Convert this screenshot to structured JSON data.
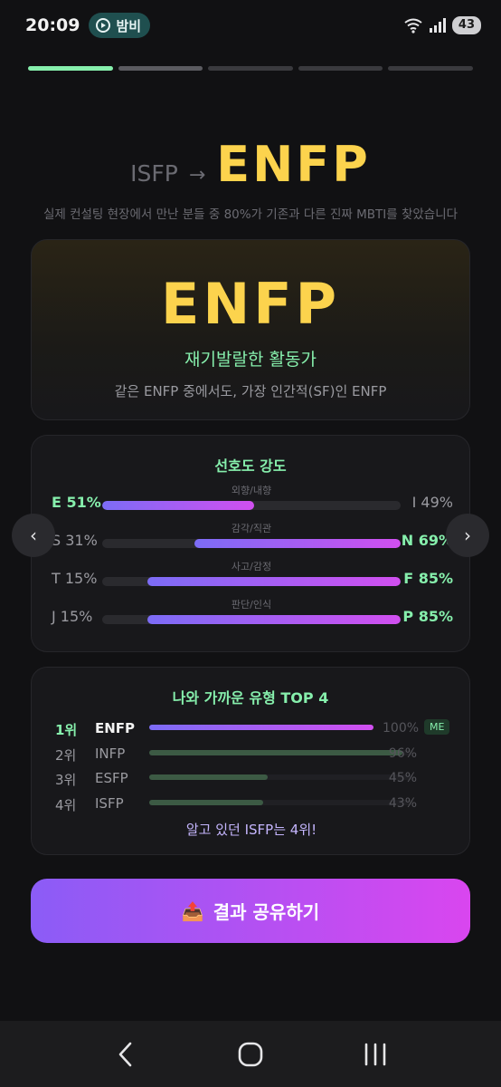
{
  "status_bar": {
    "time": "20:09",
    "app_label": "밤비",
    "battery": "43",
    "icons": [
      "wifi-icon",
      "signal-icon",
      "battery-icon"
    ]
  },
  "progress": {
    "total_steps": 5,
    "current_step": 1
  },
  "headline": {
    "from_type": "ISFP",
    "arrow": "→",
    "to_type": "ENFP",
    "subtitle": "실제 컨설팅 현장에서 만난 분들 중 80%가 기존과 다른 진짜 MBTI를 찾았습니다"
  },
  "result_card": {
    "type": "ENFP",
    "name": "재기발랄한 활동가",
    "description": "같은 ENFP 중에서도, 가장 인간적(SF)인 ENFP"
  },
  "preference": {
    "title": "선호도 강도",
    "rows": [
      {
        "caption": "외향/내향",
        "left": "E 51%",
        "right": "I 49%",
        "left_pct": 51,
        "right_pct": 49,
        "dominant": "left"
      },
      {
        "caption": "감각/직관",
        "left": "S 31%",
        "right": "N 69%",
        "left_pct": 31,
        "right_pct": 69,
        "dominant": "right"
      },
      {
        "caption": "사고/감정",
        "left": "T 15%",
        "right": "F 85%",
        "left_pct": 15,
        "right_pct": 85,
        "dominant": "right"
      },
      {
        "caption": "판단/인식",
        "left": "J 15%",
        "right": "P 85%",
        "left_pct": 15,
        "right_pct": 85,
        "dominant": "right"
      }
    ]
  },
  "carousel": {
    "prev": "‹",
    "next": "›"
  },
  "top4": {
    "title": "나와 가까운 유형 TOP 4",
    "rows": [
      {
        "rank": "1위",
        "type": "ENFP",
        "pct_label": "100%",
        "pct": 100,
        "badge": "ME"
      },
      {
        "rank": "2위",
        "type": "INFP",
        "pct_label": "96%",
        "pct": 96,
        "badge": ""
      },
      {
        "rank": "3위",
        "type": "ESFP",
        "pct_label": "45%",
        "pct": 45,
        "badge": ""
      },
      {
        "rank": "4위",
        "type": "ISFP",
        "pct_label": "43%",
        "pct": 43,
        "badge": ""
      }
    ],
    "note": "알고 있던 ISFP는 4위!"
  },
  "share": {
    "icon": "📤",
    "label": "결과 공유하기"
  },
  "colors": {
    "accent_green": "#86efac",
    "accent_yellow": "#fcd34d",
    "gradient_start": "#8b5cf6",
    "gradient_end": "#d946ef"
  }
}
